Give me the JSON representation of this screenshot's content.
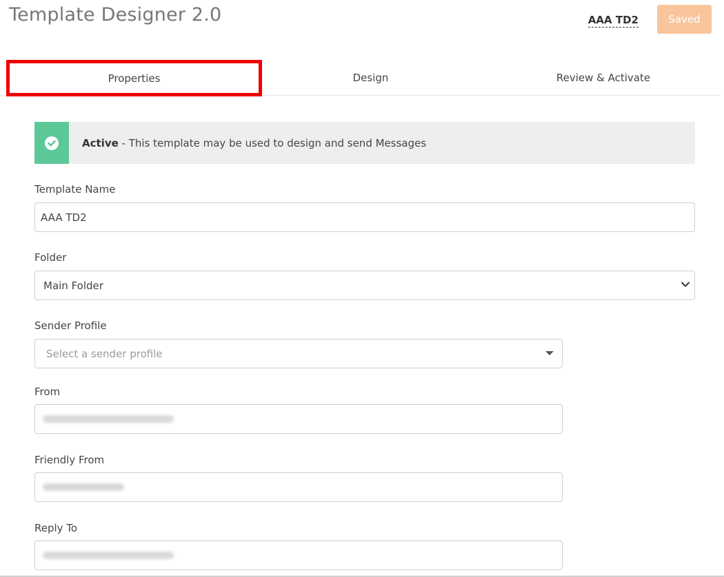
{
  "header": {
    "app_title": "Template Designer 2.0",
    "template_name": "AAA TD2",
    "saved_label": "Saved",
    "saved_color": "#f9c59d"
  },
  "tabs": [
    {
      "label": "Properties",
      "active": true
    },
    {
      "label": "Design",
      "active": false
    },
    {
      "label": "Review & Activate",
      "active": false
    }
  ],
  "status": {
    "title": "Active",
    "message": " - This template may be used to design and send Messages",
    "color": "#5cc898",
    "icon": "check-circle-icon"
  },
  "form": {
    "template_name": {
      "label": "Template Name",
      "value": "AAA TD2"
    },
    "folder": {
      "label": "Folder",
      "value": "Main Folder"
    },
    "sender_profile": {
      "label": "Sender Profile",
      "placeholder": "Select a sender profile"
    },
    "from": {
      "label": "From",
      "value_redacted": true
    },
    "friendly_from": {
      "label": "Friendly From",
      "value_redacted": true
    },
    "reply_to": {
      "label": "Reply To",
      "value_redacted": true
    }
  }
}
